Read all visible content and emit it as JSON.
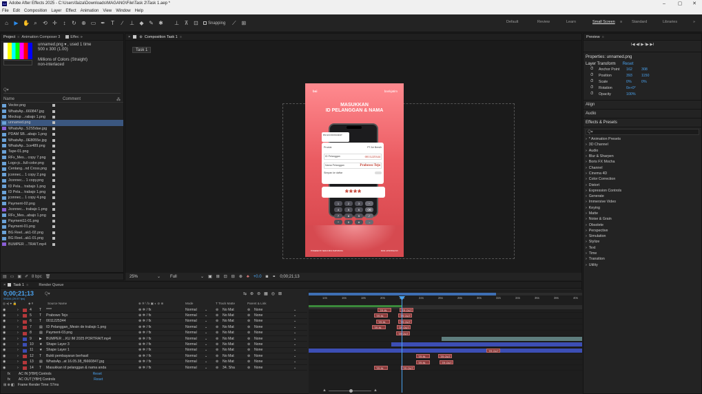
{
  "window": {
    "title": "Adobe After Effects 2025 - C:\\Users\\faiza\\Downloads\\MAGANG\\File\\Task 2\\Task 1.aep *",
    "minimize": "–",
    "maximize": "▢",
    "close": "✕"
  },
  "menu": [
    "File",
    "Edit",
    "Composition",
    "Layer",
    "Effect",
    "Animation",
    "View",
    "Window",
    "Help"
  ],
  "toolbar": {
    "snapping": "Snapping",
    "workspaces": [
      "Default",
      "Review",
      "Learn",
      "Small Screen",
      "Standard",
      "Libraries"
    ],
    "active_workspace": "Small Screen",
    "more": "»"
  },
  "project": {
    "tabs": [
      "Project",
      "Animation Composer 3",
      "Effec"
    ],
    "more": "»",
    "thumb_name": "unnamed.png ▾ , used 1 time",
    "thumb_size": "500 x 300 (1.00)",
    "thumb_colors": "Millions of Colors (Straight)",
    "thumb_interlace": "non-interlaced",
    "search_placeholder": "Q▾",
    "col_name": "Name",
    "col_comment": "Comment",
    "items": [
      {
        "name": "Vector.png",
        "type": "img"
      },
      {
        "name": "WhatsAp...660847.jpg",
        "type": "img"
      },
      {
        "name": "Mockup ...rabajo 1.png",
        "type": "img"
      },
      {
        "name": "unnamed.png",
        "type": "img",
        "selected": true
      },
      {
        "name": "WhatsAp...S2S5dae.jpg",
        "type": "vid"
      },
      {
        "name": "PDAM SB...abajo 1.png",
        "type": "img"
      },
      {
        "name": "WhatsAp...0E8055e.jpg",
        "type": "img"
      },
      {
        "name": "WhatsAp...1ce489.png",
        "type": "img"
      },
      {
        "name": "Tape-01.png",
        "type": "img"
      },
      {
        "name": "RFx_Mes... copy 7.png",
        "type": "img"
      },
      {
        "name": "Logo-jc...full-color.png",
        "type": "img"
      },
      {
        "name": "Centang...nd Cross.png",
        "type": "img"
      },
      {
        "name": "jconnec... 1 copy 2.png",
        "type": "img"
      },
      {
        "name": "Jconnec... 1 copy.png",
        "type": "img"
      },
      {
        "name": "ID Pela... trabajo 1.png",
        "type": "img"
      },
      {
        "name": "ID Pela... trabajo 1.png",
        "type": "img"
      },
      {
        "name": "jconnec... 1 copy 4.png",
        "type": "img"
      },
      {
        "name": "Payment-02.png",
        "type": "img"
      },
      {
        "name": "Jconnec... trabajo 1.png",
        "type": "vid"
      },
      {
        "name": "RFx_Mes...abajo 1.png",
        "type": "img"
      },
      {
        "name": "Payment11-01.png",
        "type": "img"
      },
      {
        "name": "Payment-01.png",
        "type": "img"
      },
      {
        "name": "BG Reel...ak1-02.png",
        "type": "img"
      },
      {
        "name": "BG Reel...ak1-01.png",
        "type": "img"
      },
      {
        "name": "BUMPER ...TRAIT.mp4",
        "type": "vid"
      }
    ],
    "bpc": "8 bpc"
  },
  "comp": {
    "tab": "Composition Task 1",
    "sub": "Task 1",
    "zoom": "25%",
    "res": "Full",
    "exposure": "+0.0",
    "time": "0;00;21;13"
  },
  "mock": {
    "brand1": "bsi",
    "brand2": "bankjatim",
    "h1": "MASUKKAN",
    "h2": "ID PELANGGAN & NAMA",
    "card_hdr": "BSI ENVIRONMENT",
    "card_row1": "Produk",
    "card_row1v": "PT Air Bersih",
    "card_id_l": "ID Pelanggan",
    "card_id": "0011225344",
    "card_name_l": "Nama Pelanggan",
    "card_name": "Prabowo Tejo",
    "card_save": "Simpan ke daftar",
    "pin": "****",
    "keys": [
      "1",
      "2",
      "3",
      "−",
      "4",
      "5",
      "6",
      "⌫",
      "7",
      "8",
      "9",
      "✓",
      "*",
      "0",
      "#",
      "→"
    ],
    "foot1": "POWERED BY SEMUA BISA TERHUBUNG",
    "foot2": "BANK JATIM BISA PAY"
  },
  "props": {
    "preview": "Preview",
    "pv_controls": "I◀  ◀I  ▶  I▶  ▶I",
    "title": "Properties: unnamed.png",
    "lt": "Layer Transform",
    "reset": "Reset",
    "rows": [
      {
        "l": "Anchor Point",
        "v1": "162",
        "v2": "308"
      },
      {
        "l": "Position",
        "v1": "393",
        "v2": "1150"
      },
      {
        "l": "Scale",
        "v1": "0%",
        "v2": "0%"
      },
      {
        "l": "Rotation",
        "v1": "0x+0°",
        "v2": ""
      },
      {
        "l": "Opacity",
        "v1": "100%",
        "v2": ""
      }
    ],
    "align": "Align",
    "audio": "Audio",
    "effects": "Effects & Presets",
    "search": "Q▾",
    "list": [
      "* Animation Presets",
      "3D Channel",
      "Audio",
      "Blur & Sharpen",
      "Boris FX Mocha",
      "Channel",
      "Cinema 4D",
      "Color Correction",
      "Distort",
      "Expression Controls",
      "Generate",
      "Immersive Video",
      "Keying",
      "Matte",
      "Noise & Grain",
      "Obsolete",
      "Perspective",
      "Simulation",
      "Stylize",
      "Text",
      "Time",
      "Transition",
      "Utility"
    ]
  },
  "timeline": {
    "tab": "Task 1",
    "rq": "Render Queue",
    "time": "0;00;21;13",
    "fps": "00644 (29.97 fps)",
    "search": "Q▾",
    "hdr": {
      "src": "Source Name",
      "mode": "Mode",
      "tt": "T  Track Matte",
      "parent": "Parent & Link"
    },
    "rulers": [
      "14s",
      "16s",
      "18s",
      "20s",
      "22s",
      "24s",
      "26s",
      "28s",
      "30s",
      "32s",
      "34s",
      "36s",
      "38s",
      "40s"
    ],
    "layers": [
      {
        "n": "4",
        "name": "****",
        "t": "T",
        "c": "#b5383b"
      },
      {
        "n": "5",
        "name": "Prabowo Tejo",
        "t": "T",
        "c": "#b5383b"
      },
      {
        "n": "6",
        "name": "0011225344",
        "t": "T",
        "c": "#b5383b"
      },
      {
        "n": "7",
        "name": "ID Pelanggan_Mesin de trabajo 1.png",
        "t": "img",
        "c": "#b5383b"
      },
      {
        "n": "8",
        "name": "Payment-03.png",
        "t": "img",
        "c": "#b5383b"
      },
      {
        "n": "9",
        "name": "BUMPER ...KU IM 2025 PORTRAIT.mp4",
        "t": "vid",
        "c": "#3c4eb4"
      },
      {
        "n": "10",
        "name": "Shape Layer 3",
        "t": "★",
        "c": "#3c4eb4"
      },
      {
        "n": "11",
        "name": "Shape Layer 1",
        "t": "★",
        "c": "#3c4eb4"
      },
      {
        "n": "12",
        "name": "Bukti pembayaran berhasil",
        "t": "T",
        "c": "#b5383b"
      },
      {
        "n": "13",
        "name": "WhatsAp...at 16.05.38_f6660847.jpg",
        "t": "img",
        "c": "#b5383b"
      },
      {
        "n": "14",
        "name": "Masukkan  id pelanggan & nama anda",
        "t": "T",
        "c": "#b5383b"
      }
    ],
    "mode": "Normal",
    "matte": "No Mat",
    "matte14": "34. Sha",
    "none": "None",
    "fx1": "AC IN [YBH] Controls",
    "fx2": "AC OUT [YBH] Controls",
    "reset": "Reset",
    "footer": "Frame Render Time: 57ms",
    "kf_in": "TR IN",
    "kf_out": "TR OUT"
  }
}
